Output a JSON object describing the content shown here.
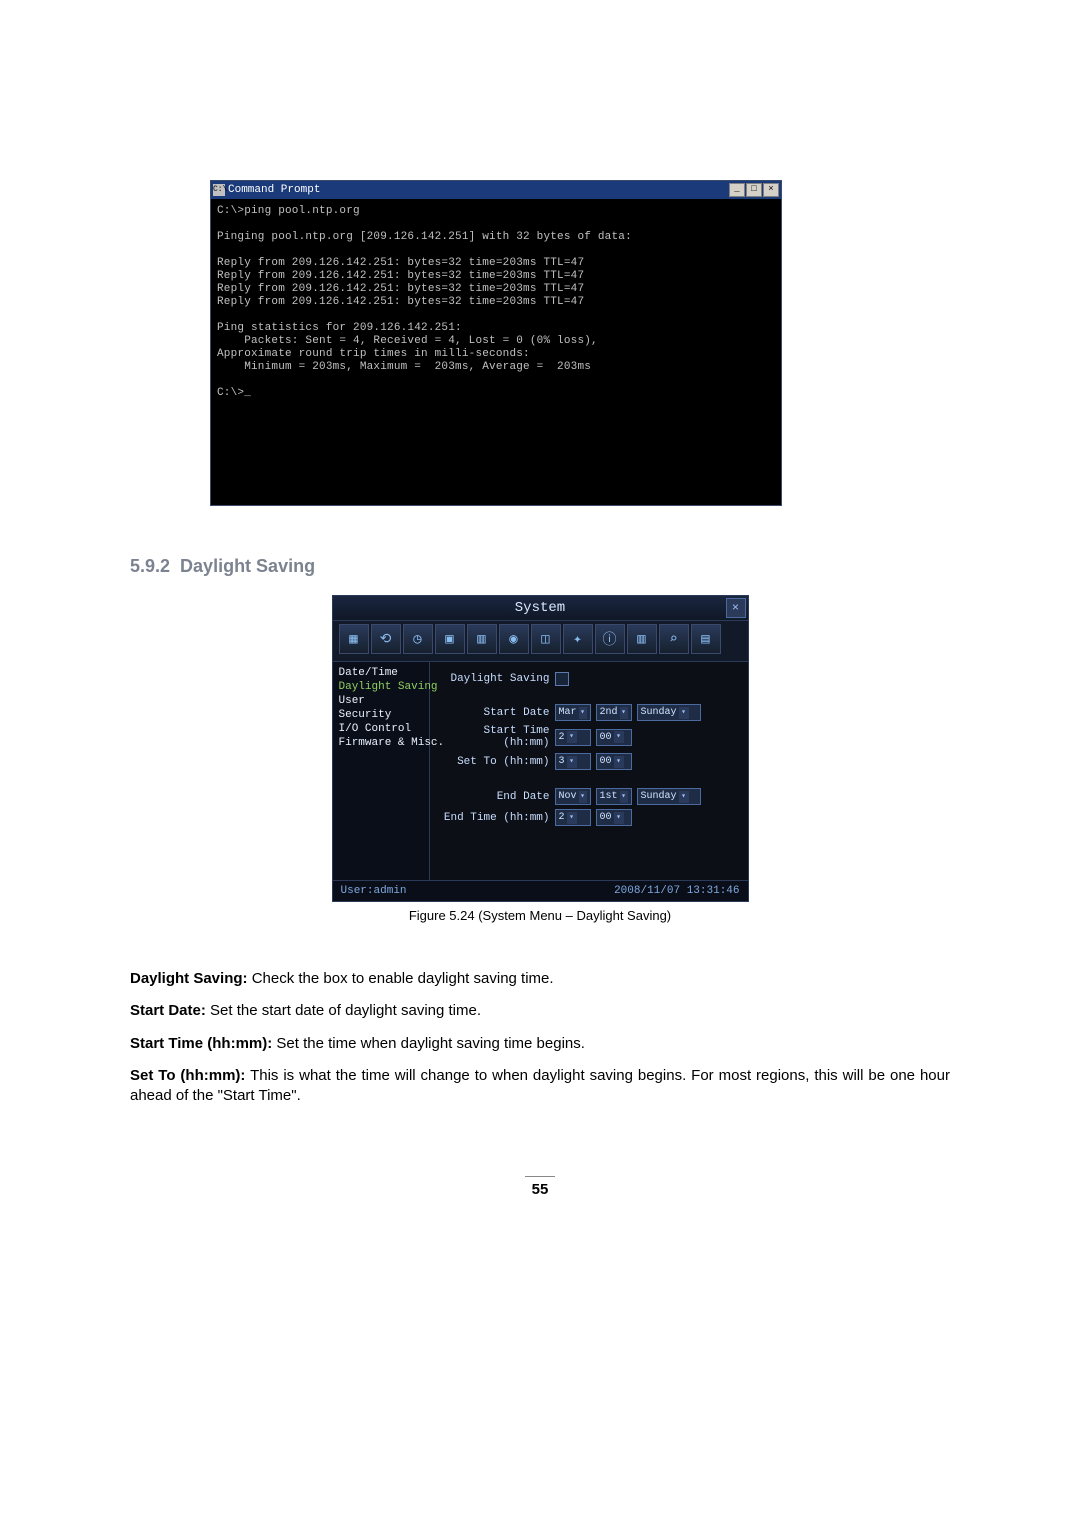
{
  "cmd": {
    "title": "Command Prompt",
    "icon_label": "C:\\",
    "min": "_",
    "max": "□",
    "close": "×",
    "lines": "C:\\>ping pool.ntp.org\n\nPinging pool.ntp.org [209.126.142.251] with 32 bytes of data:\n\nReply from 209.126.142.251: bytes=32 time=203ms TTL=47\nReply from 209.126.142.251: bytes=32 time=203ms TTL=47\nReply from 209.126.142.251: bytes=32 time=203ms TTL=47\nReply from 209.126.142.251: bytes=32 time=203ms TTL=47\n\nPing statistics for 209.126.142.251:\n    Packets: Sent = 4, Received = 4, Lost = 0 (0% loss),\nApproximate round trip times in milli-seconds:\n    Minimum = 203ms, Maximum =  203ms, Average =  203ms\n\nC:\\>_"
  },
  "heading": {
    "number": "5.9.2",
    "title": "Daylight Saving"
  },
  "sys": {
    "title": "System",
    "close": "×",
    "toolbar_icons": [
      "grid-icon",
      "back-icon",
      "clock-icon",
      "user-icon",
      "chip-icon",
      "camera-icon",
      "layout-icon",
      "magic-icon",
      "info-icon",
      "card-icon",
      "search-icon",
      "exit-icon"
    ],
    "toolbar_glyphs": [
      "▦",
      "⟲",
      "◷",
      "▣",
      "▥",
      "◉",
      "◫",
      "✦",
      "ⓘ",
      "▥",
      "⌕",
      "▤"
    ],
    "sidebar": [
      "Date/Time",
      "Daylight Saving",
      "User",
      "Security",
      "I/O Control",
      "Firmware & Misc."
    ],
    "sidebar_selected_index": 1,
    "content": {
      "ds_label": "Daylight Saving",
      "start_date_label": "Start Date",
      "start_date": {
        "month": "Mar",
        "week": "2nd",
        "day": "Sunday"
      },
      "start_time_label": "Start Time (hh:mm)",
      "start_time": {
        "h": "2",
        "m": "00"
      },
      "set_to_label": "Set To (hh:mm)",
      "set_to": {
        "h": "3",
        "m": "00"
      },
      "end_date_label": "End Date",
      "end_date": {
        "month": "Nov",
        "week": "1st",
        "day": "Sunday"
      },
      "end_time_label": "End Time (hh:mm)",
      "end_time": {
        "h": "2",
        "m": "00"
      }
    },
    "status": {
      "user_label": "User:",
      "user": "admin",
      "datetime": "2008/11/07  13:31:46"
    }
  },
  "caption": "Figure 5.24 (System Menu – Daylight Saving)",
  "copy": {
    "p1_term": "Daylight Saving:",
    "p1_body": " Check the box to enable daylight saving time.",
    "p2_term": "Start Date:",
    "p2_body": " Set the start date of daylight saving time.",
    "p3_term": "Start Time (hh:mm):",
    "p3_body": " Set the time when daylight saving time begins.",
    "p4_term": "Set To (hh:mm):",
    "p4_body": " This is what the time will change to when daylight saving begins. For most regions, this will be one hour ahead of the \"Start Time\"."
  },
  "page_number": "55"
}
